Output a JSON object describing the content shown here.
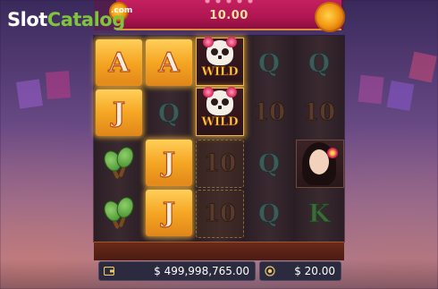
{
  "watermark": {
    "brand_slot": "Slot",
    "brand_catalog": "Catalog",
    "brand_com": ".com"
  },
  "header": {
    "win_value": "10.00"
  },
  "reels": {
    "columns": [
      [
        "A",
        "J",
        "maraca",
        "maraca"
      ],
      [
        "A",
        "Q",
        "J",
        "J"
      ],
      [
        "WILD",
        "WILD",
        "10",
        "10"
      ],
      [
        "Q",
        "10",
        "Q",
        "Q"
      ],
      [
        "Q",
        "10",
        "lady",
        "K"
      ]
    ],
    "wild_label": "WILD"
  },
  "footer": {
    "balance": "$ 499,998,765.00",
    "bet": "$ 20.00"
  },
  "colors": {
    "highlight": "#f5a623",
    "banner": "#c4205e",
    "brand_green": "#7fc43c"
  },
  "icons": {
    "balance": "wallet-icon",
    "bet": "coins-icon"
  }
}
